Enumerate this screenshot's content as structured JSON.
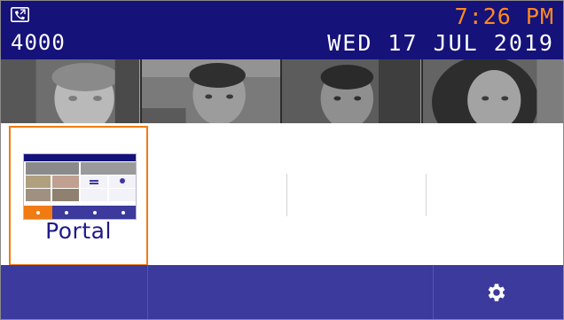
{
  "status_bar": {
    "phone_icon": "phone-handset-icon",
    "extension": "4000",
    "time": "7:26 PM",
    "date": "WED 17 JUL 2019",
    "background_color": "#15127a",
    "time_color": "#ff8a1e"
  },
  "favorites": {
    "items": [
      {
        "icon": "contact-photo"
      },
      {
        "icon": "contact-photo"
      },
      {
        "icon": "contact-photo"
      },
      {
        "icon": "contact-photo"
      }
    ]
  },
  "apps": {
    "portal": {
      "label": "Portal",
      "border_color": "#f07b12",
      "label_color": "#1f1a8c",
      "thumbnail_icon": "portal-screenshot-thumbnail"
    }
  },
  "bottom_bar": {
    "settings_icon": "gear-icon",
    "background_color": "#3c3a9c"
  }
}
